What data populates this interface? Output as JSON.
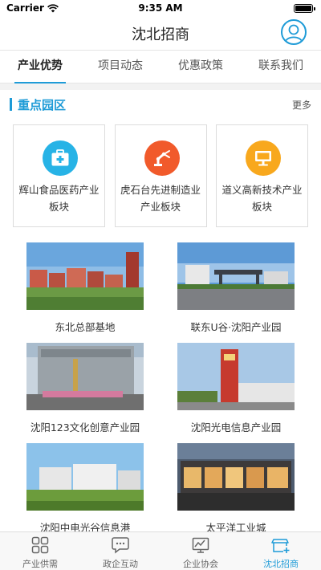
{
  "status": {
    "carrier": "Carrier",
    "time": "9:35 AM"
  },
  "header": {
    "title": "沈北招商"
  },
  "tabs": [
    {
      "label": "产业优势",
      "active": true
    },
    {
      "label": "项目动态",
      "active": false
    },
    {
      "label": "优惠政策",
      "active": false
    },
    {
      "label": "联系我们",
      "active": false
    }
  ],
  "section": {
    "title": "重点园区",
    "more": "更多"
  },
  "parks": [
    {
      "name": "辉山食品医药产业板块",
      "icon": "medical-kit-icon",
      "color": "#27b3e6"
    },
    {
      "name": "虎石台先进制造业产业板块",
      "icon": "robot-arm-icon",
      "color": "#f15a2b"
    },
    {
      "name": "道义高新技术产业板块",
      "icon": "monitor-icon",
      "color": "#f8a81d"
    }
  ],
  "gallery": [
    {
      "caption": "东北总部基地"
    },
    {
      "caption": "联东U谷·沈阳产业园"
    },
    {
      "caption": "沈阳123文化创意产业园"
    },
    {
      "caption": "沈阳光电信息产业园"
    },
    {
      "caption": "沈阳中电光谷信息港"
    },
    {
      "caption": "太平洋工业城"
    }
  ],
  "bottom_tabs": [
    {
      "label": "产业供需",
      "icon": "grid-icon",
      "active": false
    },
    {
      "label": "政企互动",
      "icon": "chat-icon",
      "active": false
    },
    {
      "label": "企业协会",
      "icon": "chart-icon",
      "active": false
    },
    {
      "label": "沈北招商",
      "icon": "store-icon",
      "active": true
    }
  ],
  "colors": {
    "accent": "#1e9bd7"
  }
}
